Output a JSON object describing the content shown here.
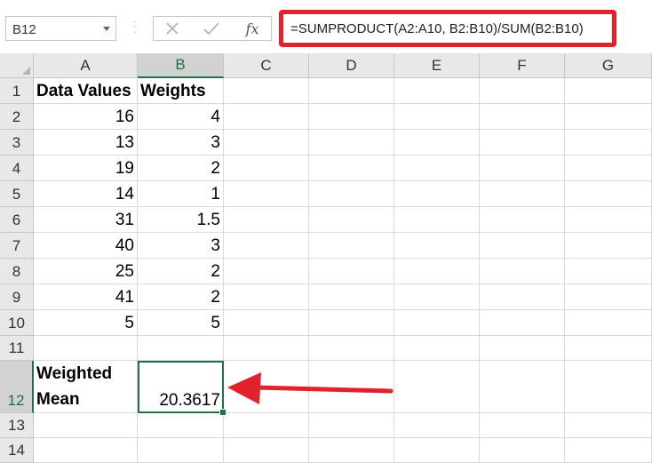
{
  "name_box": {
    "value": "B12"
  },
  "formula_bar": {
    "formula": "=SUMPRODUCT(A2:A10, B2:B10)/SUM(B2:B10)",
    "fx_label": "fx"
  },
  "columns": [
    "A",
    "B",
    "C",
    "D",
    "E",
    "F",
    "G"
  ],
  "active_column": "B",
  "rows": [
    "1",
    "2",
    "3",
    "4",
    "5",
    "6",
    "7",
    "8",
    "9",
    "10",
    "11",
    "12",
    "13",
    "14"
  ],
  "active_row": "12",
  "sheet": {
    "header_a": "Data Values",
    "header_b": "Weights",
    "data": [
      {
        "a": "16",
        "b": "4"
      },
      {
        "a": "13",
        "b": "3"
      },
      {
        "a": "19",
        "b": "2"
      },
      {
        "a": "14",
        "b": "1"
      },
      {
        "a": "31",
        "b": "1.5"
      },
      {
        "a": "40",
        "b": "3"
      },
      {
        "a": "25",
        "b": "2"
      },
      {
        "a": "41",
        "b": "2"
      },
      {
        "a": "5",
        "b": "5"
      }
    ],
    "result_label_line1": "Weighted",
    "result_label_line2": "Mean",
    "result_value": "20.3617"
  },
  "colors": {
    "highlight_red": "#e3212b",
    "excel_green": "#217346"
  }
}
